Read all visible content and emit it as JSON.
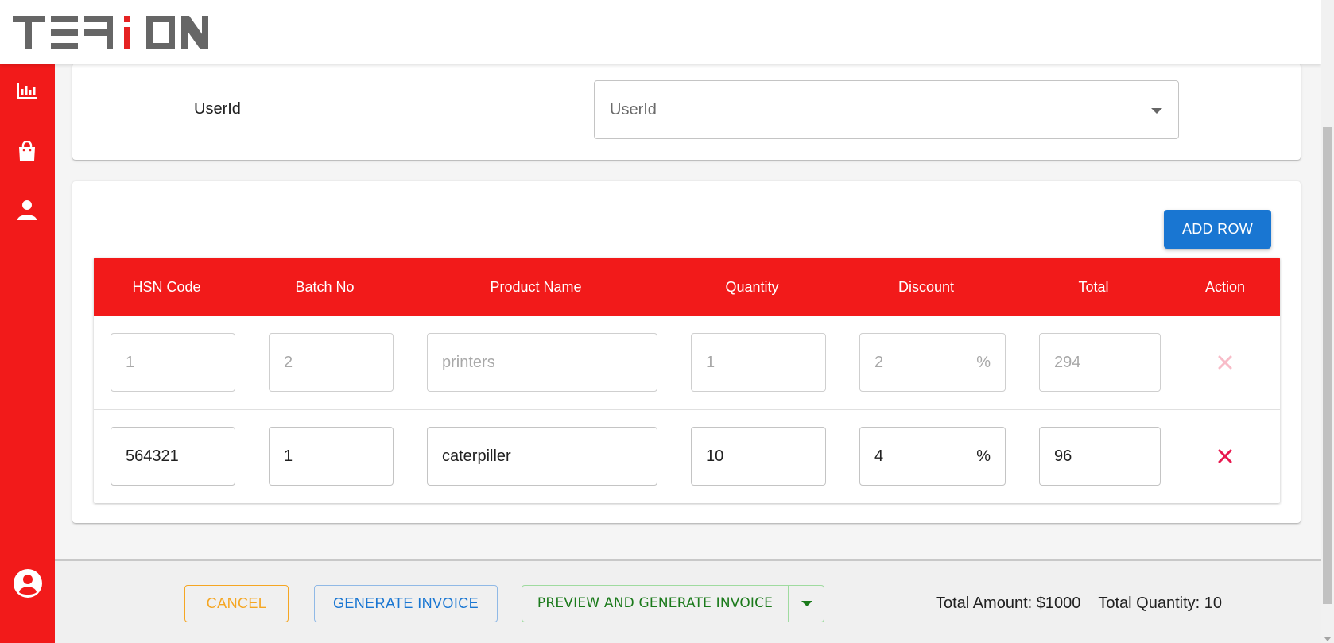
{
  "brand": {
    "logo_text": "TEFiON",
    "accent": "#f21a1a"
  },
  "sidebar": {
    "items": [
      {
        "icon": "bar-chart-icon"
      },
      {
        "icon": "shopping-bag-icon"
      },
      {
        "icon": "person-icon"
      }
    ],
    "bottom_icon": "account-circle-icon"
  },
  "user_section": {
    "label": "UserId",
    "select_placeholder": "UserId"
  },
  "table": {
    "add_row_label": "ADD ROW",
    "headers": [
      "HSN Code",
      "Batch No",
      "Product Name",
      "Quantity",
      "Discount",
      "Total",
      "Action"
    ],
    "rows": [
      {
        "hsn": "1",
        "batch": "2",
        "product": "printers",
        "quantity": "1",
        "discount": "2",
        "discount_unit": "%",
        "total": "294",
        "disabled": true
      },
      {
        "hsn": "564321",
        "batch": "1",
        "product": "caterpiller",
        "quantity": "10",
        "discount": "4",
        "discount_unit": "%",
        "total": "96",
        "disabled": false
      }
    ]
  },
  "footer": {
    "cancel_label": "CANCEL",
    "generate_label": "GENERATE INVOICE",
    "preview_label": "PREVIEW AND GENERATE INVOICE",
    "total_amount": "Total Amount: $1000",
    "total_quantity": "Total Quantity: 10"
  }
}
